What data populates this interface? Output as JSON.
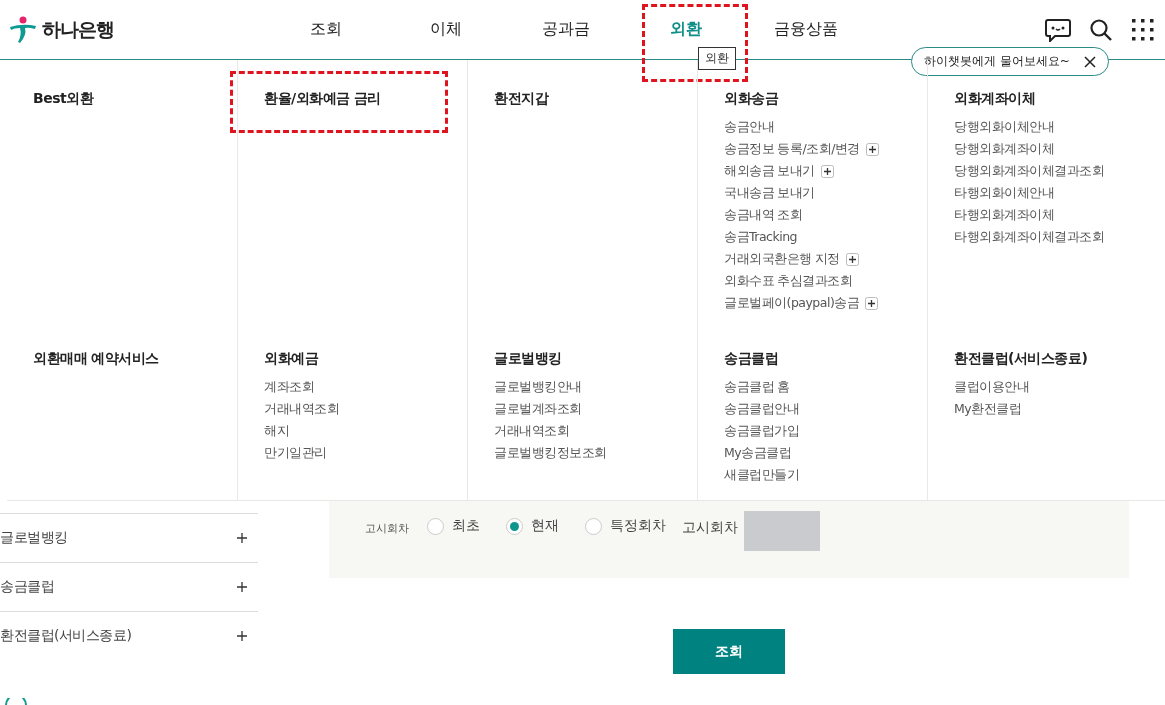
{
  "header": {
    "logo": "하나은행",
    "nav": [
      {
        "label": "조회",
        "selected": false,
        "highlighted": false
      },
      {
        "label": "이체",
        "selected": false,
        "highlighted": false
      },
      {
        "label": "공과금",
        "selected": false,
        "highlighted": false
      },
      {
        "label": "외환",
        "selected": true,
        "highlighted": true,
        "tooltip": "외환"
      },
      {
        "label": "금융상품",
        "selected": false,
        "highlighted": false
      }
    ],
    "chat_tip": "하이챗봇에게 물어보세요~"
  },
  "mega_menu": [
    {
      "title": "Best외환",
      "highlighted": false
    },
    {
      "title": "환율/외화예금 금리",
      "highlighted": true
    },
    {
      "title": "환전지갑",
      "highlighted": false
    },
    {
      "title": "외화송금",
      "highlighted": false,
      "items": [
        {
          "label": "송금안내",
          "expandable": false
        },
        {
          "label": "송금정보 등록/조회/변경",
          "expandable": true
        },
        {
          "label": "해외송금 보내기",
          "expandable": true
        },
        {
          "label": "국내송금 보내기",
          "expandable": false
        },
        {
          "label": "송금내역 조회",
          "expandable": false
        },
        {
          "label": "송금Tracking",
          "expandable": false
        },
        {
          "label": "거래외국환은행 지정",
          "expandable": true
        },
        {
          "label": "외화수표 추심결과조회",
          "expandable": false
        },
        {
          "label": "글로벌페이(paypal)송금",
          "expandable": true
        }
      ]
    },
    {
      "title": "외화계좌이체",
      "highlighted": false,
      "items": [
        {
          "label": "당행외화이체안내",
          "expandable": false
        },
        {
          "label": "당행외화계좌이체",
          "expandable": false
        },
        {
          "label": "당행외화계좌이체결과조회",
          "expandable": false
        },
        {
          "label": "타행외화이체안내",
          "expandable": false
        },
        {
          "label": "타행외화계좌이체",
          "expandable": false
        },
        {
          "label": "타행외화계좌이체결과조회",
          "expandable": false
        }
      ]
    },
    {
      "title": "외환매매 예약서비스",
      "highlighted": false
    },
    {
      "title": "외화예금",
      "highlighted": false,
      "items": [
        {
          "label": "계좌조회",
          "expandable": false
        },
        {
          "label": "거래내역조회",
          "expandable": false
        },
        {
          "label": "해지",
          "expandable": false
        },
        {
          "label": "만기일관리",
          "expandable": false
        }
      ]
    },
    {
      "title": "글로벌뱅킹",
      "highlighted": false,
      "items": [
        {
          "label": "글로벌뱅킹안내",
          "expandable": false
        },
        {
          "label": "글로벌계좌조회",
          "expandable": false
        },
        {
          "label": "거래내역조회",
          "expandable": false
        },
        {
          "label": "글로벌뱅킹정보조회",
          "expandable": false
        }
      ]
    },
    {
      "title": "송금클럽",
      "highlighted": false,
      "items": [
        {
          "label": "송금클럽 홈",
          "expandable": false
        },
        {
          "label": "송금클럽안내",
          "expandable": false
        },
        {
          "label": "송금클럽가입",
          "expandable": false
        },
        {
          "label": "My송금클럽",
          "expandable": false
        },
        {
          "label": "새클럽만들기",
          "expandable": false
        }
      ]
    },
    {
      "title": "환전클럽(서비스종료)",
      "highlighted": false,
      "items": [
        {
          "label": "클럽이용안내",
          "expandable": false
        },
        {
          "label": "My환전클럽",
          "expandable": false
        }
      ]
    }
  ],
  "sidebar": [
    {
      "label": "글로벌뱅킹",
      "expanded": false
    },
    {
      "label": "송금클럽",
      "expanded": false
    },
    {
      "label": "환전클럽(서비스종료)",
      "expanded": false
    }
  ],
  "search_panel": {
    "label": "고시회차",
    "options": [
      {
        "label": "최초",
        "selected": false
      },
      {
        "label": "현재",
        "selected": true
      },
      {
        "label": "특정회차",
        "selected": false
      }
    ],
    "field_label": "고시회차",
    "field_disabled": true
  },
  "submit": "조회"
}
